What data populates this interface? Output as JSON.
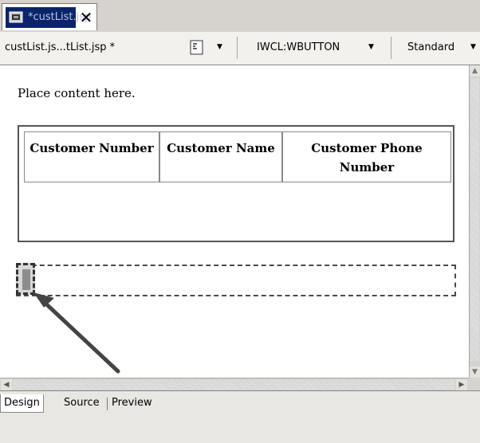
{
  "editor_tab": {
    "title": "*custList.jsp",
    "icon": "jsp-file-icon",
    "close": "✕"
  },
  "toolbar": {
    "file_label": "custList.js...tList.jsp *",
    "tag_combo": "IWCL:WBUTTON",
    "style_combo": "Standard"
  },
  "canvas": {
    "placeholder_text": "Place content here.",
    "table": {
      "columns": [
        "Customer Number",
        "Customer Name",
        "Customer Phone Number"
      ]
    }
  },
  "bottom_tabs": [
    "Design",
    "Source",
    "Preview"
  ]
}
